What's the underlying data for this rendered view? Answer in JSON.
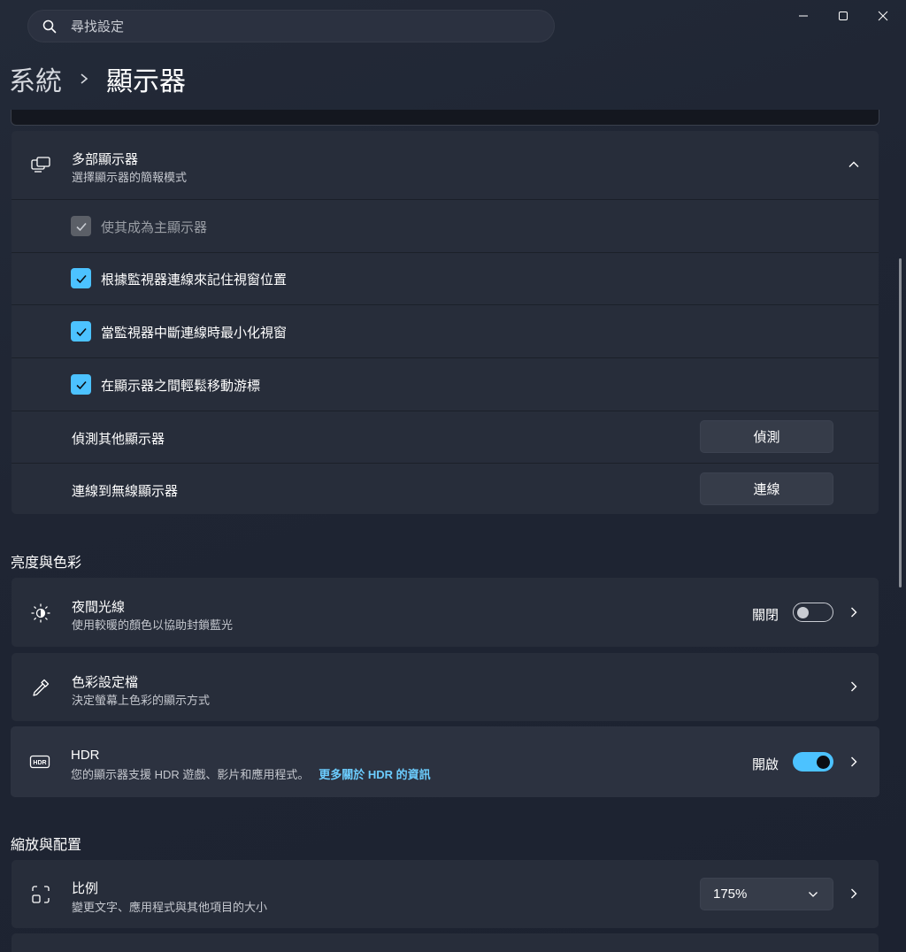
{
  "search": {
    "placeholder": "尋找設定",
    "icon": "search-icon"
  },
  "window_controls": [
    "minimize-icon",
    "maximize-icon",
    "close-icon"
  ],
  "breadcrumb": {
    "parent": "系統",
    "current": "顯示器"
  },
  "multi_display": {
    "title": "多部顯示器",
    "subtitle": "選擇顯示器的簡報模式",
    "icon": "multi-monitor-icon",
    "expanded": true,
    "options": [
      {
        "label": "使其成為主顯示器",
        "checked": true,
        "disabled": true
      },
      {
        "label": "根據監視器連線來記住視窗位置",
        "checked": true,
        "disabled": false
      },
      {
        "label": "當監視器中斷連線時最小化視窗",
        "checked": true,
        "disabled": false
      },
      {
        "label": "在顯示器之間輕鬆移動游標",
        "checked": true,
        "disabled": false
      }
    ],
    "detect": {
      "label": "偵測其他顯示器",
      "button": "偵測"
    },
    "wireless": {
      "label": "連線到無線顯示器",
      "button": "連線"
    }
  },
  "brightness_section": {
    "header": "亮度與色彩",
    "night_light": {
      "title": "夜間光線",
      "subtitle": "使用較暖的顏色以協助封鎖藍光",
      "state_label": "關閉",
      "on": false,
      "icon": "night-light-icon"
    },
    "color_profile": {
      "title": "色彩設定檔",
      "subtitle": "決定螢幕上色彩的顯示方式",
      "icon": "eyedropper-icon"
    },
    "hdr": {
      "title": "HDR",
      "subtitle": "您的顯示器支援 HDR 遊戲、影片和應用程式。",
      "link": "更多關於 HDR 的資訊",
      "state_label": "開啟",
      "on": true,
      "icon": "hdr-icon"
    }
  },
  "scale_section": {
    "header": "縮放與配置",
    "scale": {
      "title": "比例",
      "subtitle": "變更文字、應用程式與其他項目的大小",
      "value": "175%",
      "icon": "scale-icon"
    }
  },
  "colors": {
    "accent": "#4cc2ff",
    "card": "#272d3a",
    "background": "#1c2230"
  }
}
